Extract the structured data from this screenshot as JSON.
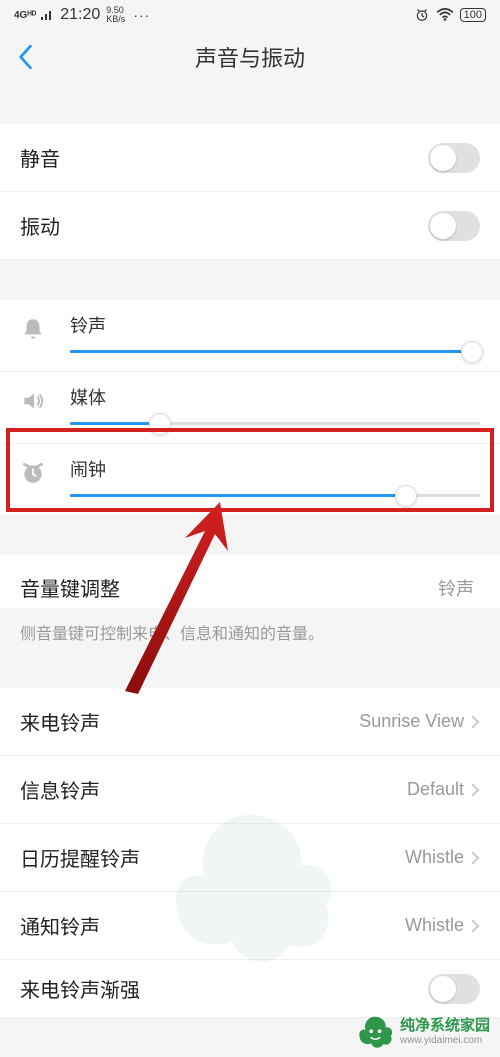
{
  "status_bar": {
    "network": "4Gᴴᴰ",
    "time": "21:20",
    "speed_val": "9.50",
    "speed_unit": "KB/s",
    "dots": "···",
    "battery": "100"
  },
  "header": {
    "title": "声音与振动"
  },
  "toggles": {
    "mute_label": "静音",
    "vibrate_label": "振动"
  },
  "sliders": {
    "ringtone": {
      "label": "铃声",
      "percent": 98
    },
    "media": {
      "label": "媒体",
      "percent": 22
    },
    "alarm": {
      "label": "闹钟",
      "percent": 82
    }
  },
  "volume_key": {
    "label": "音量键调整",
    "value": "铃声",
    "desc": "侧音量键可控制来电、信息和通知的音量。"
  },
  "ringtones": {
    "incoming": {
      "label": "来电铃声",
      "value": "Sunrise View"
    },
    "message": {
      "label": "信息铃声",
      "value": "Default"
    },
    "calendar": {
      "label": "日历提醒铃声",
      "value": "Whistle"
    },
    "notification": {
      "label": "通知铃声",
      "value": "Whistle"
    },
    "crescendo": {
      "label": "来电铃声渐强"
    }
  },
  "watermark": {
    "name": "纯净系统家园",
    "url": "www.yidaimei.com"
  }
}
